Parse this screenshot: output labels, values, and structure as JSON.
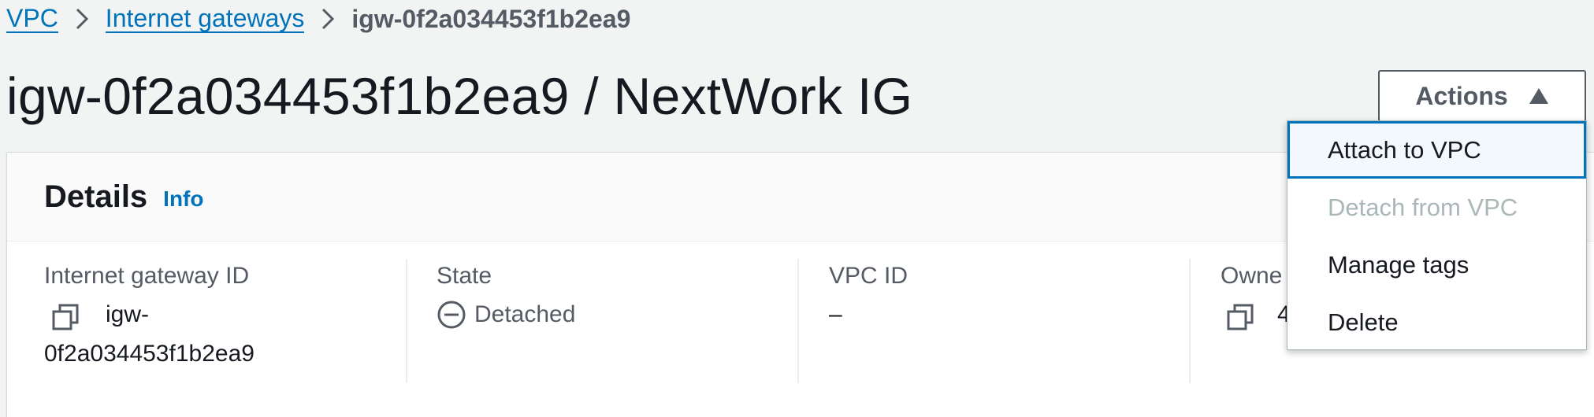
{
  "breadcrumb": {
    "items": [
      {
        "label": "VPC"
      },
      {
        "label": "Internet gateways"
      }
    ],
    "current": "igw-0f2a034453f1b2ea9"
  },
  "page": {
    "title": "igw-0f2a034453f1b2ea9 / NextWork IG"
  },
  "actions": {
    "label": "Actions",
    "menu": [
      {
        "label": "Attach to VPC",
        "state": "focused"
      },
      {
        "label": "Detach from VPC",
        "state": "disabled"
      },
      {
        "label": "Manage tags",
        "state": "normal"
      },
      {
        "label": "Delete",
        "state": "normal"
      }
    ]
  },
  "details": {
    "title": "Details",
    "info": "Info",
    "fields": {
      "gateway_id": {
        "label": "Internet gateway ID",
        "value_line1": "igw-",
        "value_line2": "0f2a034453f1b2ea9"
      },
      "state": {
        "label": "State",
        "value": "Detached"
      },
      "vpc_id": {
        "label": "VPC ID",
        "value": "–"
      },
      "owner": {
        "label": "Owne",
        "value": "4"
      }
    }
  },
  "colors": {
    "link": "#0073bb",
    "text": "#16191f",
    "muted": "#545b64",
    "disabled": "#aab7b8",
    "background": "#f2f3f3"
  },
  "icons": [
    "chevron-right-icon",
    "caret-up-icon",
    "copy-icon",
    "status-stopped-icon"
  ]
}
